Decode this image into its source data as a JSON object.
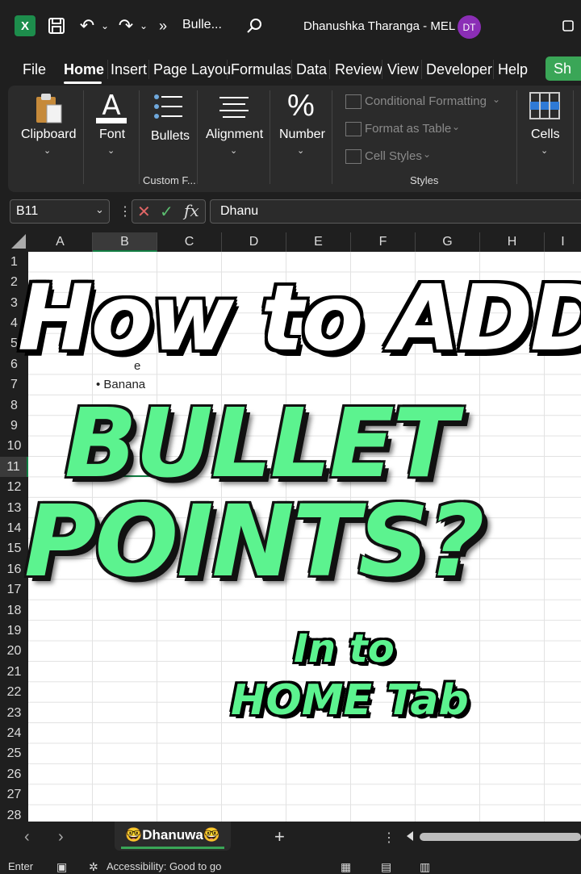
{
  "titlebar": {
    "doc_title": "Bulle...",
    "user_name": "Dhanushka Tharanga - MEL",
    "avatar_initials": "DT",
    "more_glyph": "»"
  },
  "menu": {
    "items": [
      "File",
      "Home",
      "Insert",
      "Page Layou",
      "Formulas",
      "Data",
      "Review",
      "View",
      "Developer",
      "Help"
    ],
    "share_label": "Sh"
  },
  "ribbon": {
    "clipboard": "Clipboard",
    "font": "Font",
    "bullets": "Bullets",
    "custom_group": "Custom F...",
    "alignment": "Alignment",
    "number": "Number",
    "conditional_formatting": "Conditional Formatting",
    "format_as_table": "Format as Table",
    "cell_styles": "Cell Styles",
    "styles_group": "Styles",
    "cells": "Cells"
  },
  "formula_bar": {
    "name_box": "B11",
    "formula": "Dhanu"
  },
  "grid": {
    "columns": [
      "A",
      "B",
      "C",
      "D",
      "E",
      "F",
      "G",
      "H",
      "I"
    ],
    "rows": [
      "1",
      "2",
      "3",
      "4",
      "5",
      "6",
      "7",
      "8",
      "9",
      "10",
      "11",
      "12",
      "13",
      "14",
      "15",
      "16",
      "17",
      "18",
      "19",
      "20",
      "21",
      "22",
      "23",
      "24",
      "25",
      "26",
      "27",
      "28"
    ],
    "cell_b7": "• Banana",
    "cell_partial": "e",
    "selected_cell": "B11"
  },
  "overlay": {
    "line1": "How to ADD",
    "line2": "BULLET",
    "line3": "POINTS?",
    "line4": "In to",
    "line5": "HOME Tab"
  },
  "tabs": {
    "sheet_name": "🤓Dhanuwa🤓",
    "add_glyph": "+"
  },
  "status": {
    "mode": "Enter",
    "accessibility": "Accessibility: Good to go"
  },
  "colors": {
    "accent_green": "#5cf38f",
    "excel_green": "#107c41",
    "avatar": "#8b2eb6"
  }
}
